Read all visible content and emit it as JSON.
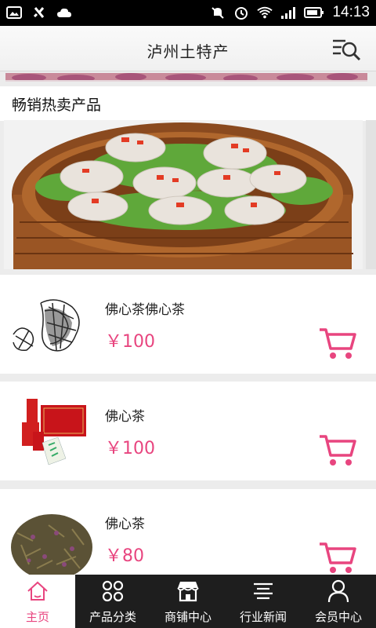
{
  "status_bar": {
    "time": "14:13",
    "icons": [
      "image-icon",
      "usb-debug-icon",
      "cloud-icon",
      "mute-icon",
      "alarm-icon",
      "wifi-icon",
      "signal-icon",
      "battery-icon"
    ]
  },
  "header": {
    "title": "泸州土特产",
    "search_icon": "search-list-icon"
  },
  "section": {
    "title": "畅销热卖产品"
  },
  "products": [
    {
      "name": "佛心茶佛心茶",
      "price": "￥100",
      "icon": "cart-icon"
    },
    {
      "name": "佛心茶",
      "price": "￥100",
      "icon": "cart-icon"
    },
    {
      "name": "佛心茶",
      "price": "￥80",
      "icon": "cart-icon"
    }
  ],
  "nav": {
    "items": [
      {
        "label": "主页",
        "icon": "home-icon",
        "active": true
      },
      {
        "label": "产品分类",
        "icon": "category-icon",
        "active": false
      },
      {
        "label": "商铺中心",
        "icon": "shop-icon",
        "active": false
      },
      {
        "label": "行业新闻",
        "icon": "news-icon",
        "active": false
      },
      {
        "label": "会员中心",
        "icon": "user-icon",
        "active": false
      }
    ]
  },
  "colors": {
    "accent": "#e8457f",
    "nav_bg": "#1e1e1e",
    "status_bg": "#000000"
  }
}
